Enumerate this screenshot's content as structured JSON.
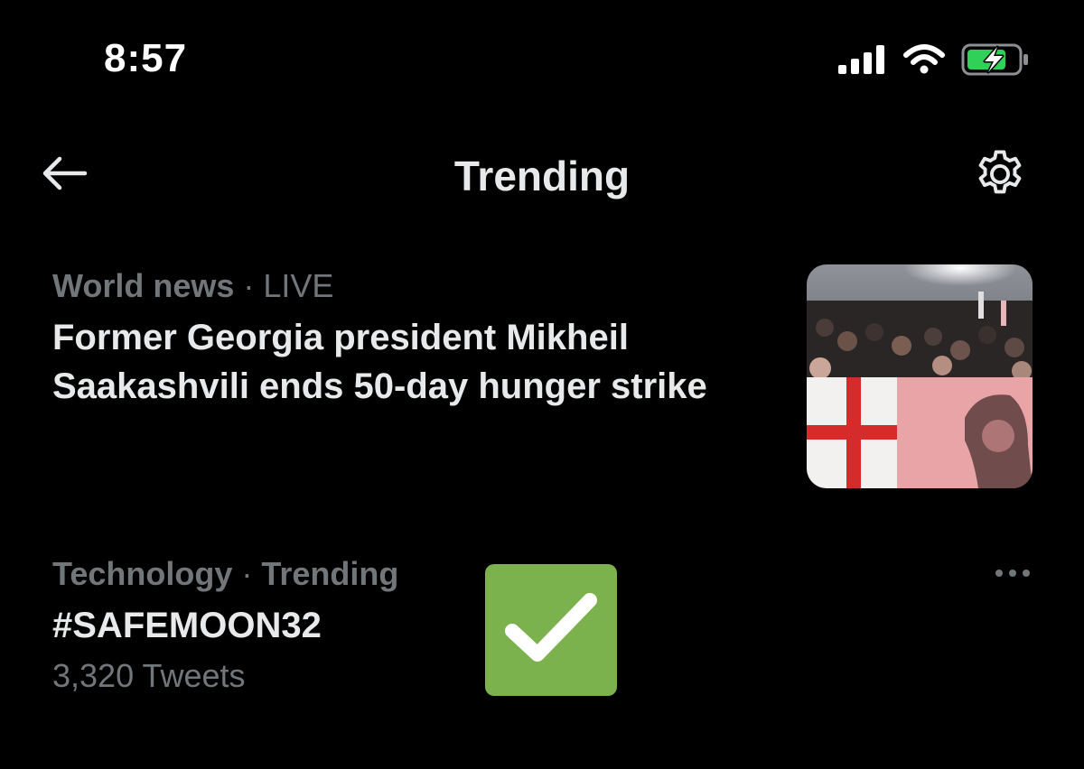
{
  "status_bar": {
    "time": "8:57",
    "icons": [
      "signal-icon",
      "wifi-icon",
      "battery-charging-icon"
    ],
    "battery_color": "#30d158"
  },
  "header": {
    "title": "Trending",
    "back_icon": "arrow-left-icon",
    "settings_icon": "gear-icon"
  },
  "trends": [
    {
      "category": "World news",
      "separator": "·",
      "state": "LIVE",
      "headline": "Former Georgia president Mikheil Saakashvili ends 50-day hunger strike",
      "has_image": true
    },
    {
      "category": "Technology",
      "separator": "·",
      "state": "Trending",
      "headline": "#SAFEMOON32",
      "count": "3,320 Tweets",
      "more_icon": "more-horizontal-icon"
    }
  ],
  "overlay": {
    "icon": "checkmark-icon",
    "color": "#7bb24e"
  }
}
